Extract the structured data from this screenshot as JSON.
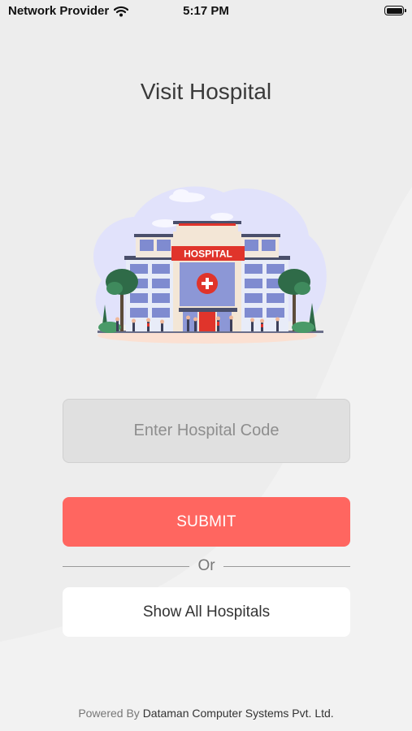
{
  "status_bar": {
    "carrier": "Network Provider",
    "time": "5:17 PM"
  },
  "title": "Visit Hospital",
  "illustration": {
    "sign_text": "HOSPITAL"
  },
  "form": {
    "code_placeholder": "Enter Hospital Code",
    "code_value": "",
    "submit_label": "SUBMIT",
    "divider_text": "Or",
    "show_all_label": "Show All Hospitals"
  },
  "footer": {
    "prefix": "Powered By",
    "company": "Dataman Computer Systems Pvt. Ltd."
  },
  "colors": {
    "background": "#ededed",
    "submit": "#ff6660",
    "input_bg": "#e0e0e0",
    "sign": "#e0342b"
  }
}
